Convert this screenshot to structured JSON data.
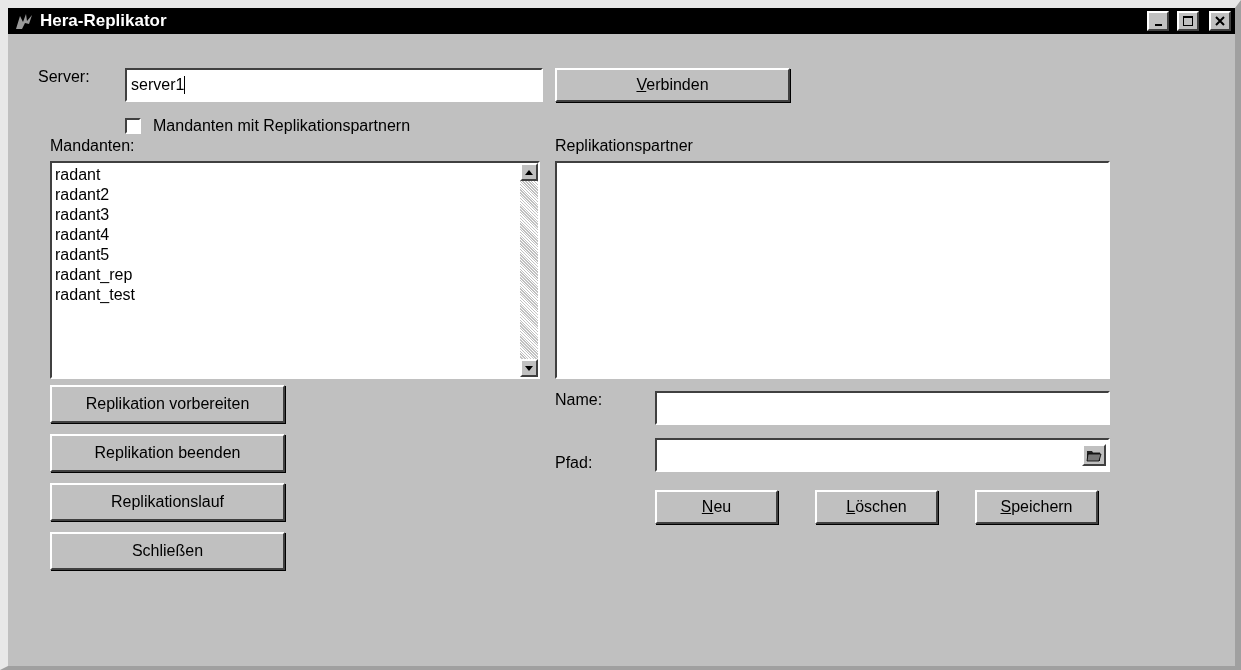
{
  "window": {
    "title": "Hera-Replikator"
  },
  "server": {
    "label": "Server:",
    "value": "server1",
    "button": {
      "label": "Verbinden",
      "mnemonic": true
    }
  },
  "filter_checkbox": {
    "label": "Mandanten mit Replikationspartnern",
    "checked": false
  },
  "mandanten": {
    "label": "Mandanten:",
    "items": [
      {
        "label": "radant",
        "selected": false
      },
      {
        "label": "radant2",
        "selected": false
      },
      {
        "label": "radant3",
        "selected": false
      },
      {
        "label": "radant4",
        "selected": false
      },
      {
        "label": "radant5",
        "selected": false
      },
      {
        "label": "radant_rep",
        "selected": false
      },
      {
        "label": "radant_test",
        "selected": false
      }
    ]
  },
  "replikationspartner": {
    "label": "Replikationspartner"
  },
  "actions": [
    {
      "label": "Replikation vorbereiten",
      "mnemonic": false
    },
    {
      "label": "Replikation beenden",
      "mnemonic": false
    },
    {
      "label": "Replikationslauf",
      "mnemonic": false
    },
    {
      "label": "Schließen",
      "mnemonic": false
    }
  ],
  "name_field": {
    "label": "Name:"
  },
  "path_field": {
    "label": "Pfad:"
  },
  "partner_buttons": [
    {
      "label": "Neu",
      "mnemonic": true
    },
    {
      "label": "Löschen",
      "mnemonic": true
    },
    {
      "label": "Speichern",
      "mnemonic": true
    }
  ]
}
